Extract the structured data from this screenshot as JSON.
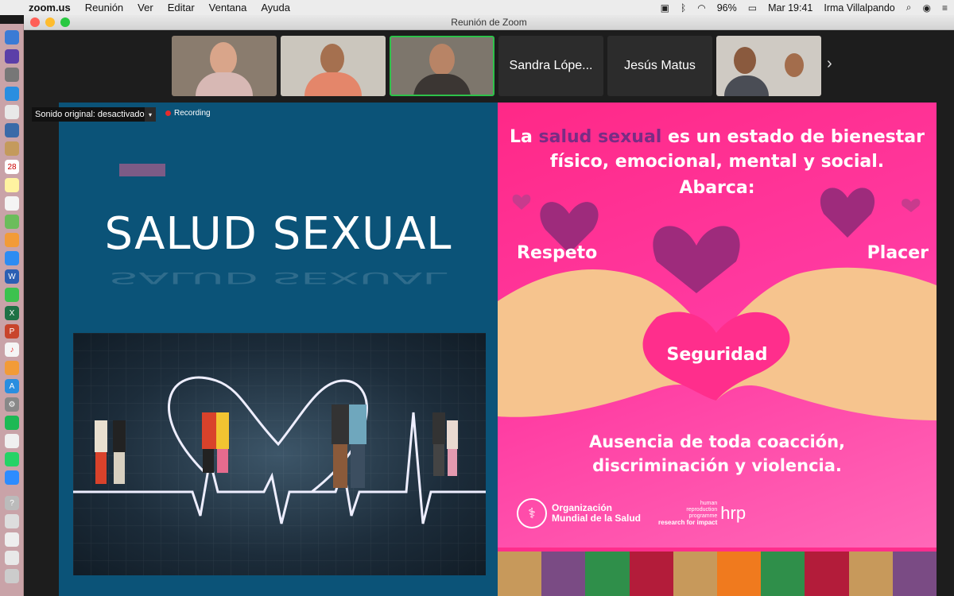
{
  "menubar": {
    "app_name": "zoom.us",
    "menus": [
      "Reunión",
      "Ver",
      "Editar",
      "Ventana",
      "Ayuda"
    ],
    "battery": "96%",
    "clock": "Mar 19:41",
    "user": "Irma Villalpando"
  },
  "window": {
    "title": "Reunión de Zoom"
  },
  "participants": [
    {
      "name": "",
      "type": "video"
    },
    {
      "name": "",
      "type": "video"
    },
    {
      "name": "",
      "type": "video",
      "active": true
    },
    {
      "name": "Sandra Lópe...",
      "type": "name"
    },
    {
      "name": "Jesús Matus",
      "type": "name"
    },
    {
      "name": "",
      "type": "video"
    }
  ],
  "share_bar": {
    "sound_label": "Sonido original: desactivado",
    "recording_label": "Recording"
  },
  "slide": {
    "left_title": "SALUD SEXUAL",
    "right_head_before": "La ",
    "right_head_highlight": "salud sexual",
    "right_head_after": " es un estado de bienestar",
    "right_head_line2": "físico, emocional, mental y social.",
    "abarca": "Abarca:",
    "respeto": "Respeto",
    "placer": "Placer",
    "seguridad": "Seguridad",
    "ausencia_line1": "Ausencia de toda coacción,",
    "ausencia_line2": "discriminación y violencia.",
    "who_line1": "Organización",
    "who_line2": "Mundial de la Salud",
    "hrp_line1": "human",
    "hrp_line2": "reproduction",
    "hrp_line3": "programme",
    "hrp_big": "hrp",
    "hrp_tagline": "research for impact",
    "stripe_colors": [
      "#c7995b",
      "#7a4b84",
      "#2f8f4a",
      "#b31c3a",
      "#c7995b",
      "#f07a1e",
      "#2f8f4a",
      "#b31c3a",
      "#c7995b",
      "#7a4b84"
    ]
  }
}
